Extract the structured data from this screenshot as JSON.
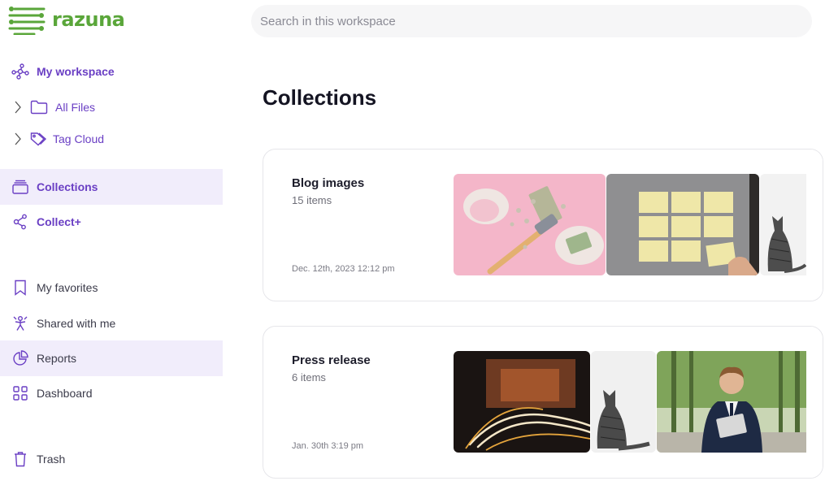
{
  "brand": {
    "name": "razuna",
    "color": "#5aa63a"
  },
  "search": {
    "placeholder": "Search in this workspace"
  },
  "sidebar": {
    "workspace": {
      "label": "My workspace",
      "icon": "workspace-network-icon"
    },
    "all_files": {
      "label": "All Files",
      "icon": "folder-icon"
    },
    "tag_cloud": {
      "label": "Tag Cloud",
      "icon": "tag-icon"
    },
    "collections": {
      "label": "Collections",
      "icon": "collections-icon",
      "selected": true
    },
    "collect_plus": {
      "label": "Collect+",
      "icon": "share-nodes-icon"
    },
    "favorites": {
      "label": "My favorites",
      "icon": "bookmark-icon"
    },
    "shared": {
      "label": "Shared with me",
      "icon": "shared-icon"
    },
    "reports": {
      "label": "Reports",
      "icon": "pie-chart-icon"
    },
    "dashboard": {
      "label": "Dashboard",
      "icon": "grid-icon"
    },
    "trash": {
      "label": "Trash",
      "icon": "trash-icon"
    }
  },
  "main": {
    "title": "Collections",
    "collections": [
      {
        "title": "Blog images",
        "count": "15 items",
        "date": "Dec. 12th, 2023 12:12 pm",
        "thumbnails": [
          "piggy-bank-coins-image",
          "sticky-notes-image",
          "cat-image"
        ]
      },
      {
        "title": "Press release",
        "count": "6 items",
        "date": "Jan. 30th 3:19 pm",
        "thumbnails": [
          "light-trails-tunnel-image",
          "cat-image",
          "businessman-image"
        ]
      }
    ]
  },
  "colors": {
    "accent": "#6a3fc4",
    "selected_bg": "#f1edfb"
  }
}
